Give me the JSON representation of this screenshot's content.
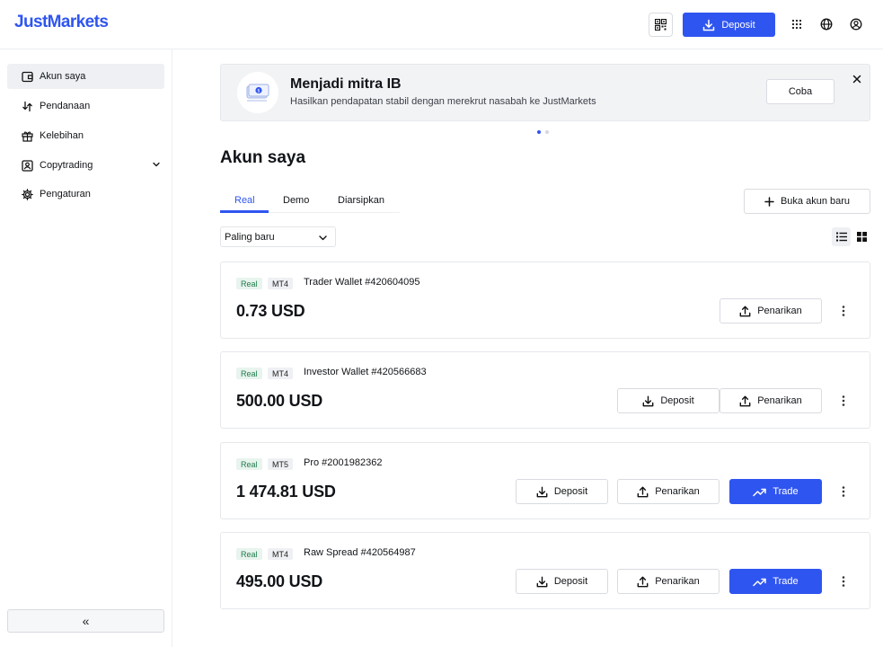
{
  "header": {
    "logo": "JustMarkets",
    "deposit_label": "Deposit"
  },
  "sidebar": {
    "items": [
      {
        "label": "Akun saya",
        "icon": "wallet-icon",
        "active": true
      },
      {
        "label": "Pendanaan",
        "icon": "transfer-icon"
      },
      {
        "label": "Kelebihan",
        "icon": "gift-icon"
      },
      {
        "label": "Copytrading",
        "icon": "copytrading-icon",
        "expandable": true
      },
      {
        "label": "Pengaturan",
        "icon": "gear-icon"
      }
    ],
    "collapse_label": "«"
  },
  "banner": {
    "title": "Menjadi mitra IB",
    "subtitle": "Hasilkan pendapatan stabil dengan merekrut nasabah ke JustMarkets",
    "button_label": "Coba"
  },
  "main": {
    "title": "Akun saya",
    "tabs": [
      {
        "label": "Real",
        "active": true
      },
      {
        "label": "Demo"
      },
      {
        "label": "Diarsipkan"
      }
    ],
    "new_account_label": "Buka akun baru",
    "sort_value": "Paling baru"
  },
  "accounts": [
    {
      "type": "Real",
      "platform": "MT4",
      "name": "Trader Wallet #420604095",
      "balance": "0.73 USD",
      "withdraw_label": "Penarikan"
    },
    {
      "type": "Real",
      "platform": "MT4",
      "name": "Investor Wallet #420566683",
      "balance": "500.00 USD",
      "deposit_label": "Deposit",
      "withdraw_label": "Penarikan"
    },
    {
      "type": "Real",
      "platform": "MT5",
      "name": "Pro #2001982362",
      "balance": "1 474.81 USD",
      "deposit_label": "Deposit",
      "withdraw_label": "Penarikan",
      "trade_label": "Trade"
    },
    {
      "type": "Real",
      "platform": "MT4",
      "name": "Raw Spread #420564987",
      "balance": "495.00 USD",
      "deposit_label": "Deposit",
      "withdraw_label": "Penarikan",
      "trade_label": "Trade"
    }
  ],
  "colors": {
    "brand": "#2f55f0",
    "real_badge_bg": "#e8f4ee",
    "real_badge_text": "#1e7b4a"
  }
}
